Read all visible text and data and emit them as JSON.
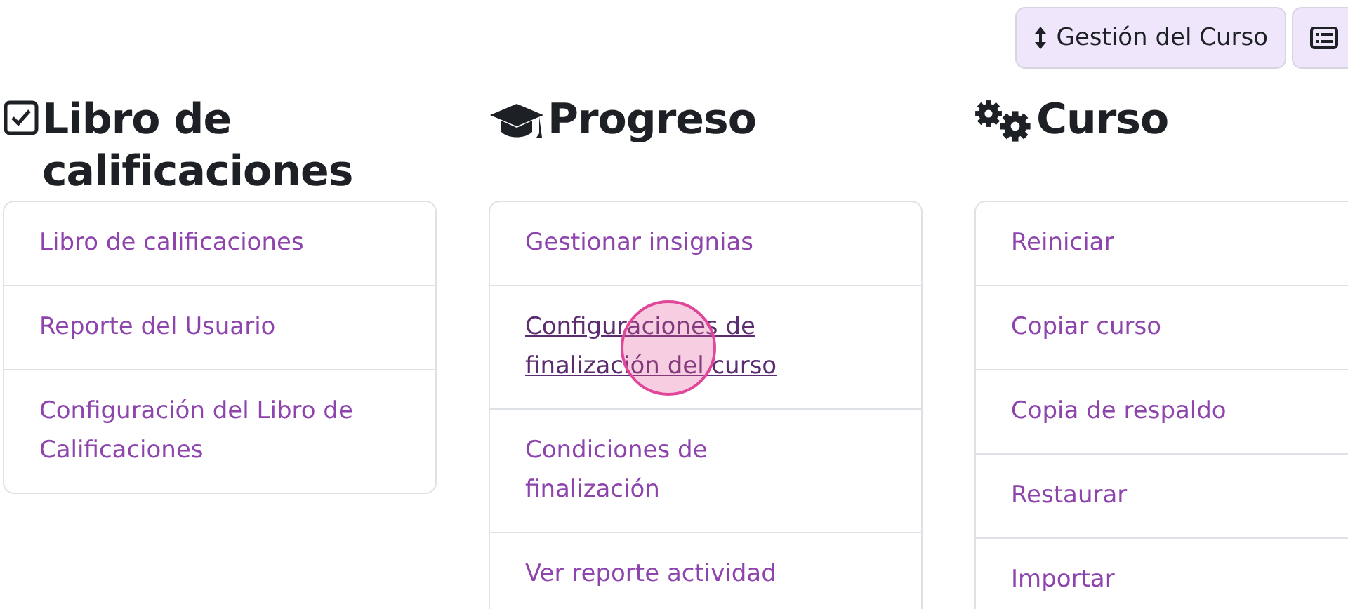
{
  "toolbar": {
    "buttons": [
      {
        "kind": "course-menu",
        "label": "Gestión del Curso"
      },
      {
        "kind": "list"
      }
    ]
  },
  "sections": [
    {
      "kind": "gradebook",
      "title": "Libro de calificaciones",
      "links": [
        {
          "label": "Libro de calificaciones",
          "hovered": false
        },
        {
          "label": "Reporte del Usuario",
          "hovered": false
        },
        {
          "label": "Configuración del Libro de Calificaciones",
          "hovered": false
        }
      ]
    },
    {
      "kind": "progress",
      "title": "Progreso",
      "links": [
        {
          "label": "Gestionar insignias",
          "hovered": false
        },
        {
          "label": "Configuraciones de finalización del curso",
          "hovered": true
        },
        {
          "label": "Condiciones de finalización",
          "hovered": false
        },
        {
          "label": "Ver reporte actividad",
          "hovered": false
        }
      ]
    },
    {
      "kind": "course",
      "title": "Curso",
      "links": [
        {
          "label": "Reiniciar",
          "hovered": false
        },
        {
          "label": "Copiar curso",
          "hovered": false
        },
        {
          "label": "Copia de respaldo",
          "hovered": false
        },
        {
          "label": "Restaurar",
          "hovered": false
        },
        {
          "label": "Importar",
          "hovered": false
        }
      ]
    }
  ]
}
